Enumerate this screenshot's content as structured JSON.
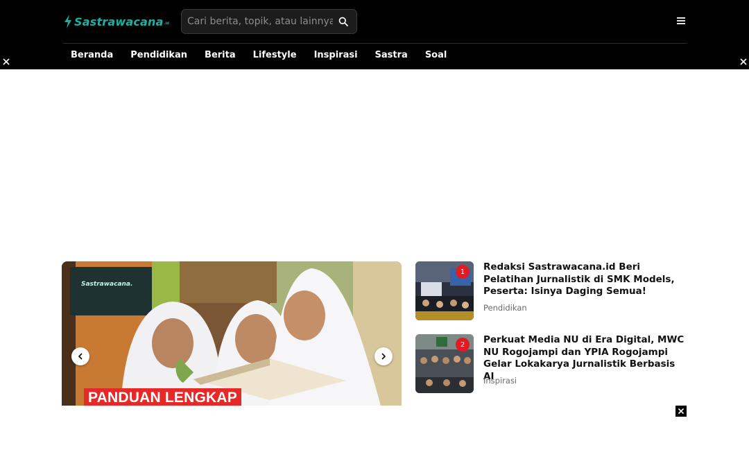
{
  "header": {
    "logo_text": "Sastrawacana",
    "logo_tld": ".id",
    "search_placeholder": "Cari berita, topik, atau lainnya",
    "search_icon": "search-icon",
    "menu_icon": "hamburger-menu-icon"
  },
  "nav": {
    "items": [
      {
        "label": "Beranda"
      },
      {
        "label": "Pendidikan"
      },
      {
        "label": "Berita"
      },
      {
        "label": "Lifestyle"
      },
      {
        "label": "Inspirasi"
      },
      {
        "label": "Sastra"
      },
      {
        "label": "Soal"
      }
    ]
  },
  "ad": {
    "close_icon": "close-icon"
  },
  "slider": {
    "watermark": "Sastrawacana.",
    "banner_text": "PANDUAN LENGKAP",
    "prev_icon": "chevron-left-icon",
    "next_icon": "chevron-right-icon"
  },
  "popular": [
    {
      "rank": "1",
      "title": "Redaksi Sastrawacana.id Beri Pelatihan Jurnalistik di SMK Models, Peserta: Isinya Daging Semua!",
      "category": "Pendidikan"
    },
    {
      "rank": "2",
      "title": "Perkuat Media NU di Era Digital, MWC NU Rogojampi dan YPIA Rogojampi Gelar Lokakarya Jurnalistik Berbasis AI",
      "category": "Inspirasi"
    }
  ],
  "colors": {
    "brand": "#1ab0a2",
    "header_bg": "#000000",
    "badge": "#e21b23",
    "banner": "#e52828"
  }
}
